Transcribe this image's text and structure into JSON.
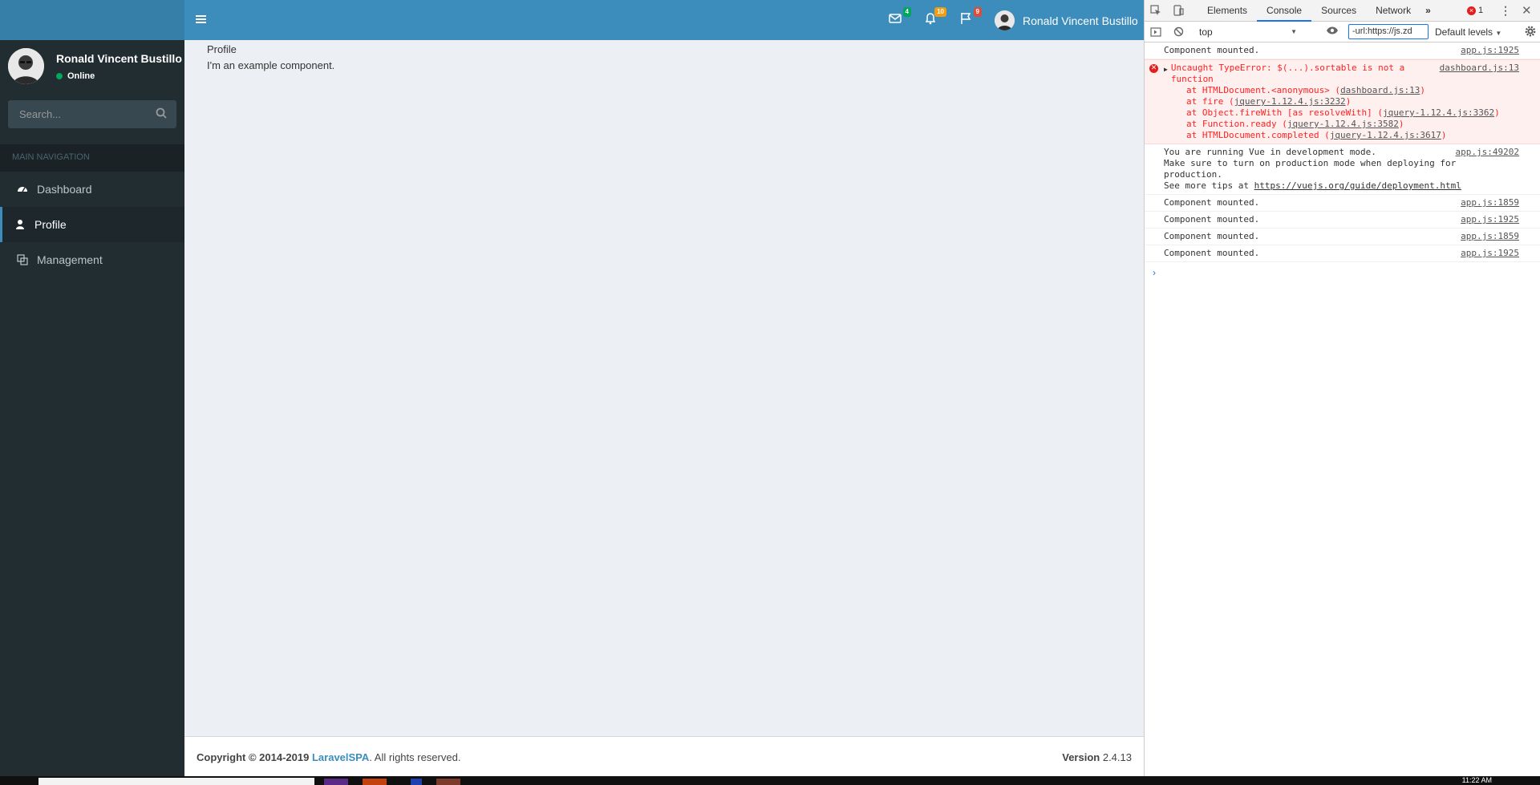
{
  "user": {
    "name": "Ronald Vincent Bustillo",
    "status": "Online"
  },
  "sidebar": {
    "search_placeholder": "Search...",
    "nav_header": "MAIN NAVIGATION",
    "items": [
      {
        "label": "Dashboard",
        "icon": "dashboard-icon",
        "active": false
      },
      {
        "label": "Profile",
        "icon": "user-icon",
        "active": true
      },
      {
        "label": "Management",
        "icon": "management-icon",
        "active": false
      }
    ]
  },
  "topbar": {
    "badges": {
      "messages": "4",
      "notifications": "10",
      "flags": "9"
    },
    "badge_colors": {
      "messages": "#00a65a",
      "notifications": "#f39c12",
      "flags": "#dd4b39"
    }
  },
  "content": {
    "title": "Profile",
    "body": "I'm an example component."
  },
  "footer": {
    "copy_prefix": "Copyright © 2014-2019",
    "brand": "LaravelSPA",
    "copy_suffix": ". All rights reserved.",
    "version_label": "Version",
    "version": "2.4.13"
  },
  "devtools": {
    "tabs": [
      "Elements",
      "Console",
      "Sources",
      "Network"
    ],
    "active_tab": "Console",
    "error_count": "1",
    "context": "top",
    "filter_value": "-url:https://js.zd",
    "levels": "Default levels",
    "lines": [
      {
        "type": "log",
        "text": "Component mounted.",
        "src": "app.js:1925"
      },
      {
        "type": "error",
        "text": "Uncaught TypeError: $(...).sortable is not a function",
        "src": "dashboard.js:13",
        "stack": [
          {
            "pre": "at HTMLDocument.<anonymous> (",
            "link": "dashboard.js:13",
            "post": ")"
          },
          {
            "pre": "at fire (",
            "link": "jquery-1.12.4.js:3232",
            "post": ")"
          },
          {
            "pre": "at Object.fireWith [as resolveWith] (",
            "link": "jquery-1.12.4.js:3362",
            "post": ")"
          },
          {
            "pre": "at Function.ready (",
            "link": "jquery-1.12.4.js:3582",
            "post": ")"
          },
          {
            "pre": "at HTMLDocument.completed (",
            "link": "jquery-1.12.4.js:3617",
            "post": ")"
          }
        ]
      },
      {
        "type": "log",
        "text": "You are running Vue in development mode.",
        "text2": "Make sure to turn on production mode when deploying for production.",
        "text3_prefix": "See more tips at ",
        "text3_link": "https://vuejs.org/guide/deployment.html",
        "src": "app.js:49202"
      },
      {
        "type": "log",
        "text": "Component mounted.",
        "src": "app.js:1859"
      },
      {
        "type": "log",
        "text": "Component mounted.",
        "src": "app.js:1925"
      },
      {
        "type": "log",
        "text": "Component mounted.",
        "src": "app.js:1859"
      },
      {
        "type": "log",
        "text": "Component mounted.",
        "src": "app.js:1925"
      }
    ]
  },
  "taskbar": {
    "clock": "11:22 AM"
  }
}
